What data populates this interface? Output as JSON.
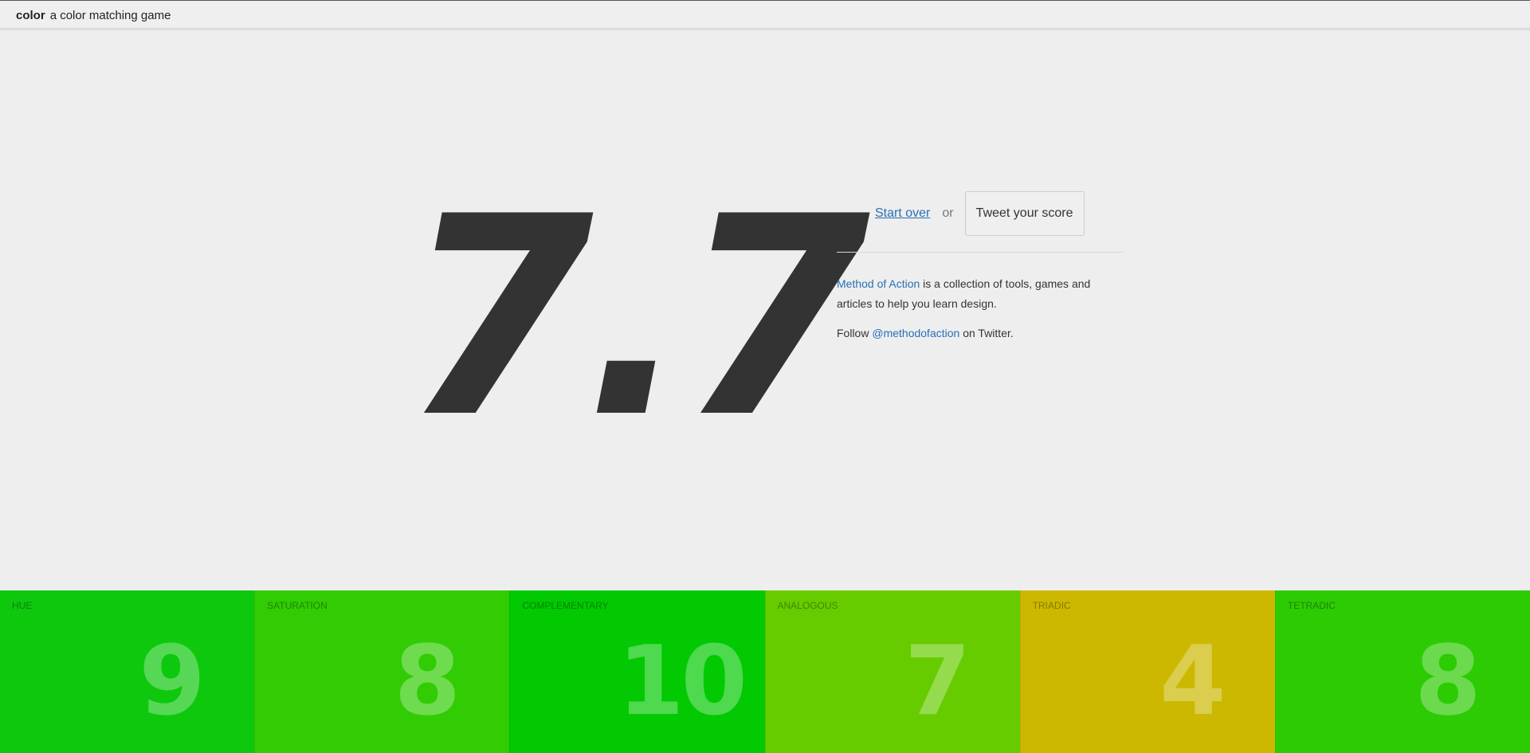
{
  "header": {
    "brand_name": "color",
    "tagline": "a color matching game"
  },
  "result": {
    "score": "7.7"
  },
  "actions": {
    "start_over": "Start over",
    "or": "or",
    "tweet": "Tweet your score"
  },
  "about": {
    "link": "Method of Action",
    "text": " is a collection of tools, games and articles to help you learn design.",
    "follow_prefix": "Follow ",
    "handle": "@methodofaction",
    "follow_suffix": " on Twitter."
  },
  "categories": [
    {
      "label": "HUE",
      "score": "9",
      "color": "#0ec80e"
    },
    {
      "label": "SATURATION",
      "score": "8",
      "color": "#31cc04"
    },
    {
      "label": "COMPLEMENTARY",
      "score": "10",
      "color": "#02c902"
    },
    {
      "label": "ANALOGOUS",
      "score": "7",
      "color": "#66cc00"
    },
    {
      "label": "TRIADIC",
      "score": "4",
      "color": "#ccb800"
    },
    {
      "label": "TETRADIC",
      "score": "8",
      "color": "#2ccb04"
    }
  ]
}
